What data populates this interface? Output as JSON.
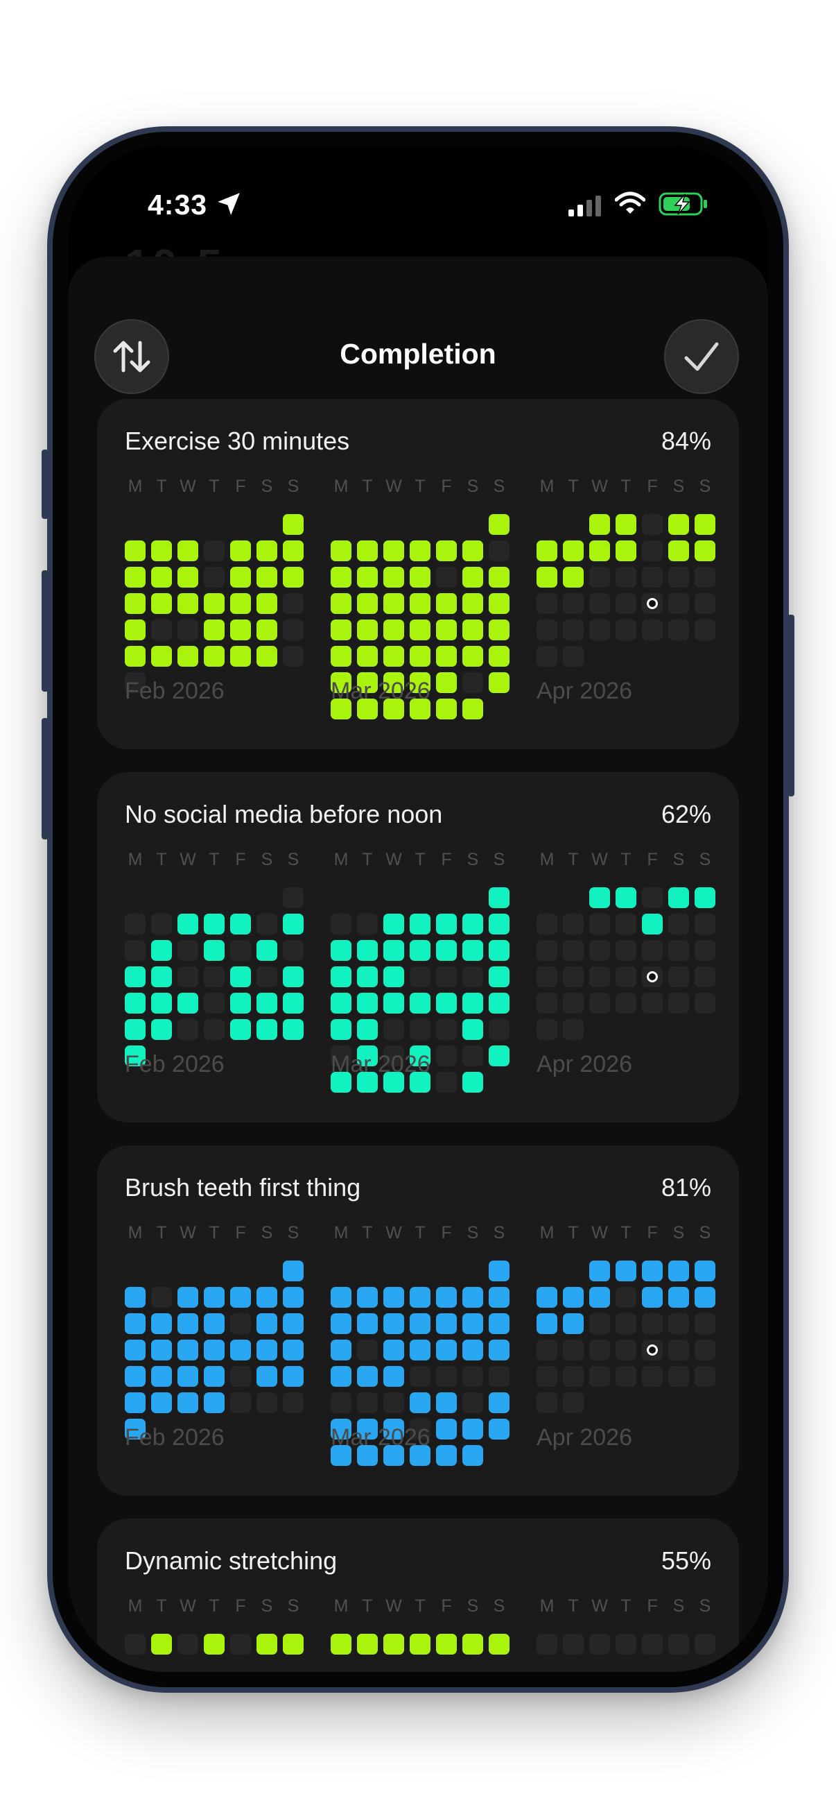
{
  "status_bar": {
    "time": "4:33"
  },
  "background_time": "10:5",
  "header": {
    "title": "Completion",
    "sort_icon": "arrows-up-down-icon",
    "done_icon": "checkmark-icon"
  },
  "weekdays": [
    "M",
    "T",
    "W",
    "T",
    "F",
    "S",
    "S"
  ],
  "habits": [
    {
      "title": "Exercise 30 minutes",
      "percent": "84%",
      "color": "#aaf30c",
      "months": [
        {
          "label": "Feb 2026",
          "days": "1111011111101111111110100111011111100"
        },
        {
          "label": "Mar 2026",
          "days": "1111111011110111111111111111111111111111101111111"
        },
        {
          "label": "Apr 2026",
          "days": "11011111101111000000000000000000000"
        }
      ]
    },
    {
      "title": "No social media before noon",
      "percent": "62%",
      "color": "#12f2c0",
      "months": [
        {
          "label": "Feb 2026",
          "days": "0001110101010101100101111011111001111"
        },
        {
          "label": "Mar 2026",
          "days": "1001111111111111110001111111111000100101001111101"
        },
        {
          "label": "Apr 2026",
          "days": "11011000010000000000000000000000000"
        }
      ]
    },
    {
      "title": "Brush teeth first thing",
      "percent": "81%",
      "color": "#2aa7f2",
      "months": [
        {
          "label": "Feb 2026",
          "days": "1101111111110111111111111101111110001"
        },
        {
          "label": "Mar 2026",
          "days": "1111111111111111011111111000000011011110111111111"
        },
        {
          "label": "Apr 2026",
          "days": "11111111011111000000000000000000000"
        }
      ]
    },
    {
      "title": "Dynamic stretching",
      "percent": "55%",
      "color": "#aaf30c",
      "months": [
        {
          "label": "",
          "days": "0101011"
        },
        {
          "label": "",
          "days": "1111111"
        },
        {
          "label": "",
          "days": "0000000"
        }
      ]
    }
  ]
}
